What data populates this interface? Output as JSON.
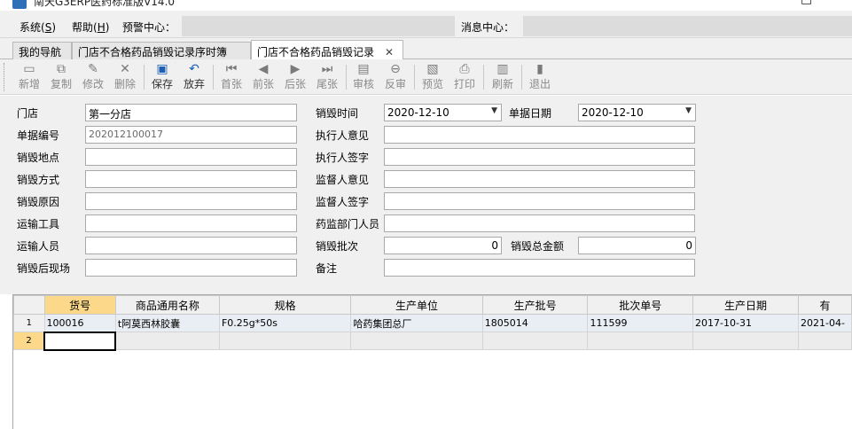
{
  "window": {
    "title": "南天G3ERP医药标准版V14.0",
    "minimize": "–",
    "maximize": "□"
  },
  "menu": {
    "system": "系统(S)",
    "system_pre": "系统(",
    "system_key": "S",
    "help_pre": "帮助(",
    "help_key": "H",
    "alert_label": "预警中心：",
    "message_label": "消息中心："
  },
  "tabs": [
    {
      "label": "我的导航"
    },
    {
      "label": "门店不合格药品销毁记录序时簿"
    },
    {
      "label": "门店不合格药品销毁记录",
      "close": "✕"
    }
  ],
  "toolbar": [
    {
      "label": "新增",
      "icon": "new-doc-icon",
      "glyph": "▭"
    },
    {
      "label": "复制",
      "icon": "copy-icon",
      "glyph": "⧉"
    },
    {
      "label": "修改",
      "icon": "edit-icon",
      "glyph": "✎"
    },
    {
      "label": "删除",
      "icon": "delete-icon",
      "glyph": "✕"
    },
    {
      "label": "保存",
      "icon": "save-icon",
      "glyph": "▣"
    },
    {
      "label": "放弃",
      "icon": "undo-icon",
      "glyph": "↶"
    },
    {
      "label": "首张",
      "icon": "first-icon",
      "glyph": "⏮"
    },
    {
      "label": "前张",
      "icon": "prev-icon",
      "glyph": "◀"
    },
    {
      "label": "后张",
      "icon": "next-icon",
      "glyph": "▶"
    },
    {
      "label": "尾张",
      "icon": "last-icon",
      "glyph": "⏭"
    },
    {
      "label": "审核",
      "icon": "audit-icon",
      "glyph": "▤"
    },
    {
      "label": "反审",
      "icon": "unaudit-icon",
      "glyph": "⊖"
    },
    {
      "label": "预览",
      "icon": "preview-icon",
      "glyph": "▧"
    },
    {
      "label": "打印",
      "icon": "print-icon",
      "glyph": "⎙"
    },
    {
      "label": "刷新",
      "icon": "refresh-icon",
      "glyph": "▥"
    },
    {
      "label": "退出",
      "icon": "exit-icon",
      "glyph": "▮"
    }
  ],
  "form": {
    "store": {
      "label": "门店",
      "value": "第一分店"
    },
    "doc_no": {
      "label": "单据编号",
      "value": "202012100017"
    },
    "place": {
      "label": "销毁地点",
      "value": ""
    },
    "method": {
      "label": "销毁方式",
      "value": ""
    },
    "reason": {
      "label": "销毁原因",
      "value": ""
    },
    "transport": {
      "label": "运输工具",
      "value": ""
    },
    "transporter": {
      "label": "运输人员",
      "value": ""
    },
    "site": {
      "label": "销毁后现场",
      "value": ""
    },
    "destroy_time": {
      "label": "销毁时间",
      "value": "2020-12-10"
    },
    "doc_date": {
      "label": "单据日期",
      "value": "2020-12-10"
    },
    "executor_opinion": {
      "label": "执行人意见",
      "value": ""
    },
    "executor_sign": {
      "label": "执行人签字",
      "value": ""
    },
    "supervisor_opinion": {
      "label": "监督人意见",
      "value": ""
    },
    "supervisor_sign": {
      "label": "监督人签字",
      "value": ""
    },
    "fda_staff": {
      "label": "药监部门人员",
      "value": ""
    },
    "batch": {
      "label": "销毁批次",
      "value": "0"
    },
    "total_amount": {
      "label": "销毁总金额",
      "value": "0"
    },
    "remark": {
      "label": "备注",
      "value": ""
    }
  },
  "grid": {
    "columns": [
      "货号",
      "商品通用名称",
      "规格",
      "生产单位",
      "生产批号",
      "批次单号",
      "生产日期",
      "有"
    ],
    "rows": [
      {
        "no": "1",
        "cells": [
          "100016",
          "t阿莫西林胶囊",
          "F0.25g*50s",
          "哈药集团总厂",
          "1805014",
          "111599",
          "2017-10-31",
          "2021-04-"
        ]
      },
      {
        "no": "2",
        "cells": [
          "",
          "",
          "",
          "",
          "",
          "",
          "",
          ""
        ]
      }
    ]
  }
}
